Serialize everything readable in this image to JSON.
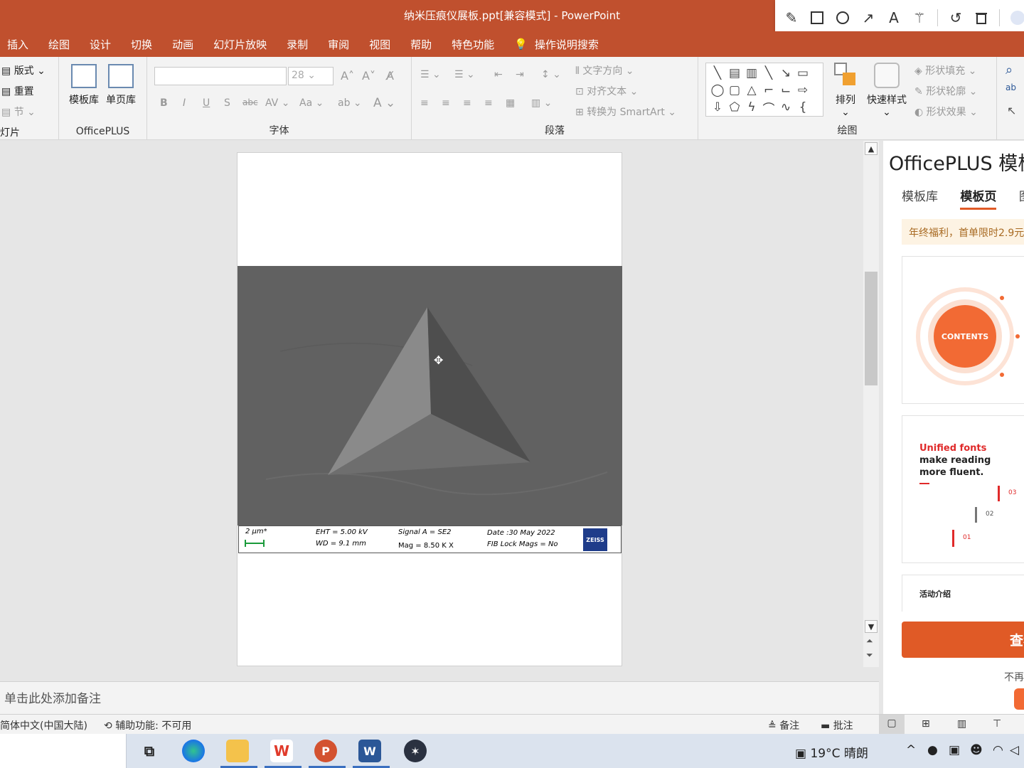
{
  "window": {
    "title": "纳米压痕仪展板.ppt[兼容模式]  -  PowerPoint"
  },
  "draw_toolbar": {
    "icons": [
      "pencil-icon",
      "rectangle-icon",
      "circle-icon",
      "arrow-icon",
      "text-icon",
      "magic-wand-icon",
      "undo-icon",
      "trash-icon"
    ]
  },
  "menu": {
    "items": [
      "插入",
      "绘图",
      "设计",
      "切换",
      "动画",
      "幻灯片放映",
      "录制",
      "审阅",
      "视图",
      "帮助",
      "特色功能"
    ],
    "tell_me": "操作说明搜索"
  },
  "ribbon": {
    "slides": {
      "layout": "版式",
      "reset": "重置",
      "section": "节",
      "label": "灯片"
    },
    "officeplus": {
      "template_lib": "模板库",
      "page_lib": "单页库",
      "label": "OfficePLUS"
    },
    "font": {
      "size": "28",
      "label": "字体"
    },
    "paragraph": {
      "text_direction": "文字方向",
      "align_text": "对齐文本",
      "convert_smartart": "转换为 SmartArt",
      "label": "段落"
    },
    "drawing": {
      "arrange": "排列",
      "quick_styles": "快速样式",
      "shape_fill": "形状填充",
      "shape_outline": "形状轮廓",
      "shape_effects": "形状效果",
      "label": "绘图"
    }
  },
  "slide": {
    "info": {
      "scale": "2 µm*",
      "eht": "EHT =  5.00 kV",
      "wd": "WD =  9.1 mm",
      "signal": "Signal A = SE2",
      "mag": "Mag =     8.50 K X",
      "date": "Date :30 May 2022",
      "fib": "FIB Lock Mags = No",
      "logo": "ZEISS"
    }
  },
  "notes": {
    "placeholder": "单击此处添加备注"
  },
  "panel": {
    "title": "OfficePLUS 模板",
    "tabs": [
      "模板库",
      "模板页",
      "图"
    ],
    "promo": "年终福利，首单限时2.9元",
    "card1": {
      "badge": "CONTENTS"
    },
    "card2": {
      "line1": "Unified fonts",
      "line2": "make reading",
      "line3": "more fluent.",
      "nums": [
        "03",
        "02",
        "01"
      ]
    },
    "card3": {
      "title": "活动介绍"
    },
    "view_button": "查看",
    "footer": "不再"
  },
  "status": {
    "language": "简体中文(中国大陆)",
    "accessibility": "辅助功能: 不可用",
    "notes": "备注",
    "comments": "批注"
  },
  "taskbar": {
    "weather": "19°C  晴朗"
  },
  "colors": {
    "accent": "#c0502e",
    "orange": "#e05a26"
  }
}
